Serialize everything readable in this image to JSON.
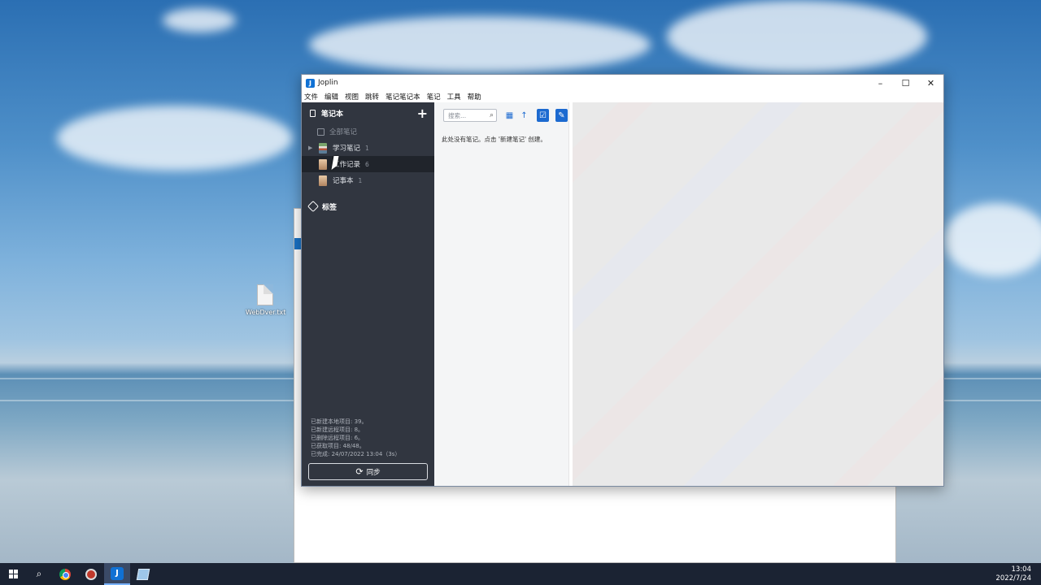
{
  "desktop": {
    "icon_label": "WebDver.txt"
  },
  "window": {
    "title": "Joplin",
    "controls": {
      "minimize": "–",
      "maximize": "☐",
      "close": "✕"
    }
  },
  "menu": [
    "文件",
    "编辑",
    "视图",
    "跳转",
    "笔记笔记本",
    "笔记",
    "工具",
    "帮助"
  ],
  "sidebar": {
    "notebooks_header": "笔记本",
    "add_symbol": "+",
    "all_notes": "全部笔记",
    "notebooks": [
      {
        "label": "学习笔记",
        "count": "1",
        "expandable": true
      },
      {
        "label": "工作记录",
        "count": "6",
        "selected": true
      },
      {
        "label": "记事本",
        "count": "1"
      }
    ],
    "tags_header": "标签",
    "sync_log": [
      "已新建本地项目: 39。",
      "已新建远程项目: 8。",
      "已删除远程项目: 6。",
      "已获取项目: 48/48。",
      "已完成: 24/07/2022 13:04（3s）"
    ],
    "sync_button": "同步"
  },
  "notelist": {
    "search_placeholder": "搜索...",
    "empty_message": "此处没有笔记。点击 '新建笔记' 创建。"
  },
  "taskbar": {
    "time": "13:04",
    "date": "2022/7/24"
  }
}
